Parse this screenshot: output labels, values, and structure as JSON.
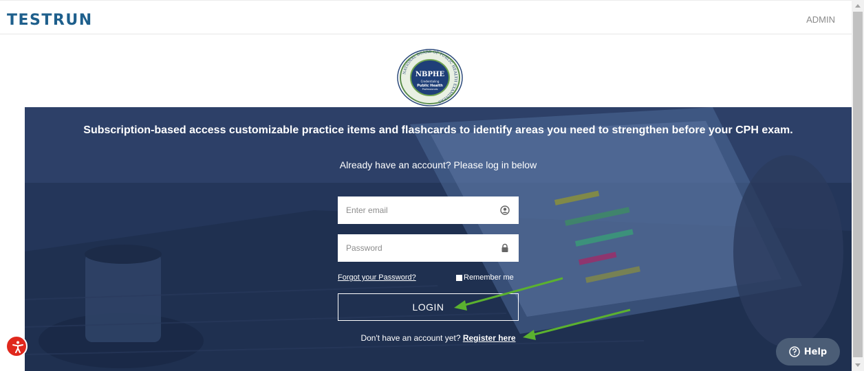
{
  "header": {
    "brand": "TESTRUN",
    "admin_label": "ADMIN"
  },
  "logo": {
    "main_text": "NBPHE",
    "sub_text_1": "Credentialing",
    "sub_text_2": "Public Health",
    "sub_text_3": "Professionals",
    "ring_text": "NATIONAL BOARD OF PUBLIC HEALTH EXAMINERS"
  },
  "hero": {
    "headline": "Subscription-based access customizable practice items and flashcards to identify areas you need to strengthen before your CPH exam.",
    "subline": "Already have an account? Please log in below"
  },
  "form": {
    "email_placeholder": "Enter email",
    "password_placeholder": "Password",
    "forgot_label": "Forgot your Password?",
    "remember_label": "Remember me",
    "login_label": "LOGIN",
    "register_prompt": "Don't have an account yet?",
    "register_label": "Register here"
  },
  "widgets": {
    "help_label": "Help",
    "accessibility_icon": "accessibility-person-icon"
  },
  "colors": {
    "brand": "#1e5f8c",
    "hero_overlay": "#26395e",
    "accessibility": "#e0281d",
    "help": "#4b5d76",
    "annotation_arrow": "#5bb12f"
  }
}
